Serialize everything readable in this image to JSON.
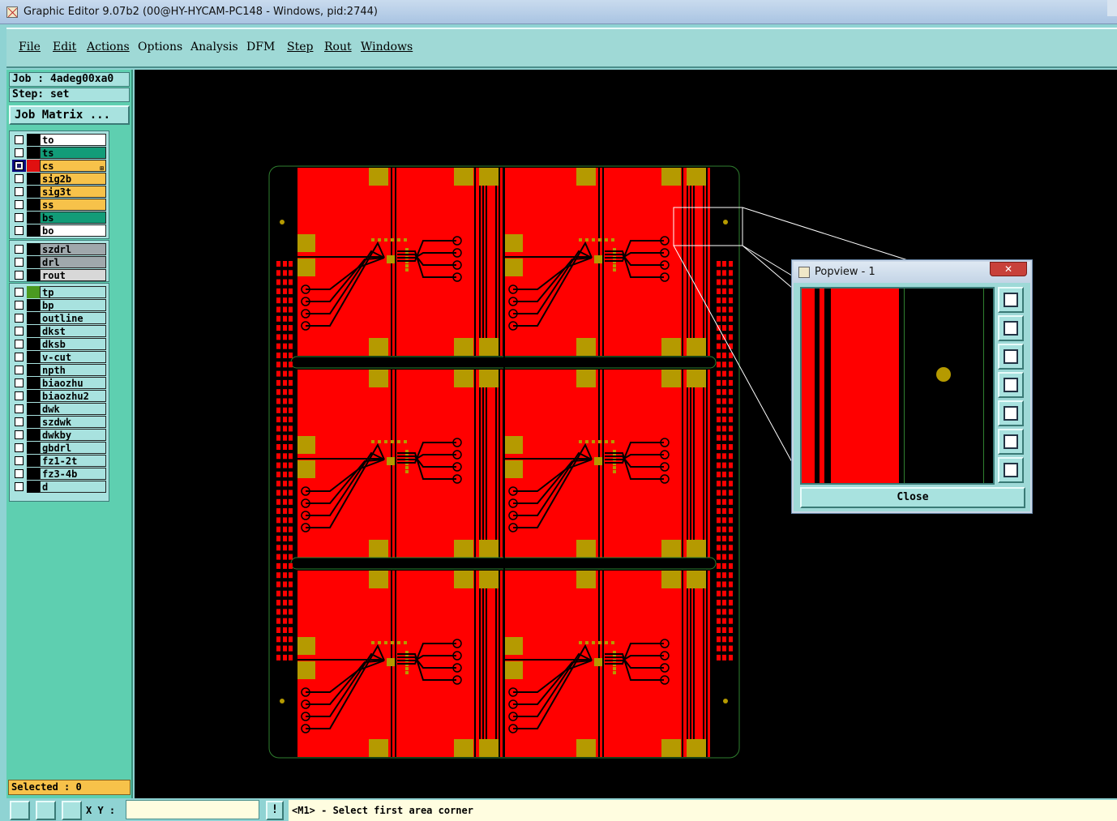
{
  "window": {
    "title": "Graphic Editor 9.07b2 (00@HY-HYCAM-PC148 - Windows, pid:2744)"
  },
  "menubar": {
    "items": [
      {
        "label": "File"
      },
      {
        "label": "Edit"
      },
      {
        "label": "Actions"
      },
      {
        "label": "Options"
      },
      {
        "label": "Analysis"
      },
      {
        "label": "DFM"
      },
      {
        "label": "Step"
      },
      {
        "label": "Rout"
      },
      {
        "label": "Windows"
      }
    ]
  },
  "info": {
    "job": "Job : 4adeg00xa0",
    "step": "Step: set",
    "job_matrix": "Job Matrix ..."
  },
  "layers": {
    "board": [
      {
        "name": "to",
        "color": "#ffffff",
        "swatch": "#000000"
      },
      {
        "name": "ts",
        "color": "#129c78",
        "swatch": "#000000"
      },
      {
        "name": "cs",
        "color": "#f7c24a",
        "swatch": "#e01010",
        "active": true
      },
      {
        "name": "sig2b",
        "color": "#f7c24a",
        "swatch": "#000000"
      },
      {
        "name": "sig3t",
        "color": "#f7c24a",
        "swatch": "#000000"
      },
      {
        "name": "ss",
        "color": "#f7c24a",
        "swatch": "#000000"
      },
      {
        "name": "bs",
        "color": "#129c78",
        "swatch": "#000000"
      },
      {
        "name": "bo",
        "color": "#ffffff",
        "swatch": "#000000"
      }
    ],
    "drill": [
      {
        "name": "szdrl",
        "color": "#a0a8ac",
        "swatch": "#000000"
      },
      {
        "name": "drl",
        "color": "#a0a8ac",
        "swatch": "#000000"
      },
      {
        "name": "rout",
        "color": "#d8d8d8",
        "swatch": "#000000"
      }
    ],
    "misc": [
      {
        "name": "tp",
        "color": "#a8e2df",
        "swatch": "#4a9a20"
      },
      {
        "name": "bp",
        "color": "#a8e2df",
        "swatch": "#000000"
      },
      {
        "name": "outline",
        "color": "#a8e2df",
        "swatch": "#000000"
      },
      {
        "name": "dkst",
        "color": "#a8e2df",
        "swatch": "#000000"
      },
      {
        "name": "dksb",
        "color": "#a8e2df",
        "swatch": "#000000"
      },
      {
        "name": "v-cut",
        "color": "#a8e2df",
        "swatch": "#000000"
      },
      {
        "name": "npth",
        "color": "#a8e2df",
        "swatch": "#000000"
      },
      {
        "name": "biaozhu",
        "color": "#a8e2df",
        "swatch": "#000000"
      },
      {
        "name": "biaozhu2",
        "color": "#a8e2df",
        "swatch": "#000000"
      },
      {
        "name": "dwk",
        "color": "#a8e2df",
        "swatch": "#000000"
      },
      {
        "name": "szdwk",
        "color": "#a8e2df",
        "swatch": "#000000"
      },
      {
        "name": "dwkby",
        "color": "#a8e2df",
        "swatch": "#000000"
      },
      {
        "name": "gbdrl",
        "color": "#a8e2df",
        "swatch": "#000000"
      },
      {
        "name": "fz1-2t",
        "color": "#a8e2df",
        "swatch": "#000000"
      },
      {
        "name": "fz3-4b",
        "color": "#a8e2df",
        "swatch": "#000000"
      },
      {
        "name": "d",
        "color": "#a8e2df",
        "swatch": "#000000"
      }
    ]
  },
  "status": {
    "selected": "Selected : 0",
    "xy_label": "X Y :",
    "xy_value": "",
    "prompt_button": "!",
    "prompt": "<M1> - Select first area corner"
  },
  "popview": {
    "title": "Popview - 1",
    "close_x": "✕",
    "close_button": "Close",
    "tools": [
      "zoom-home-icon",
      "pan-up-icon",
      "pan-down-icon",
      "pan-left-icon",
      "pan-right-icon",
      "zoom-fit-icon",
      "zoom-extents-icon"
    ]
  },
  "colors": {
    "copper": "#ff0000",
    "pad": "#b59a00",
    "outline": "#2f7f2f",
    "canvas": "#000000",
    "panel": "#5ecfb0"
  }
}
